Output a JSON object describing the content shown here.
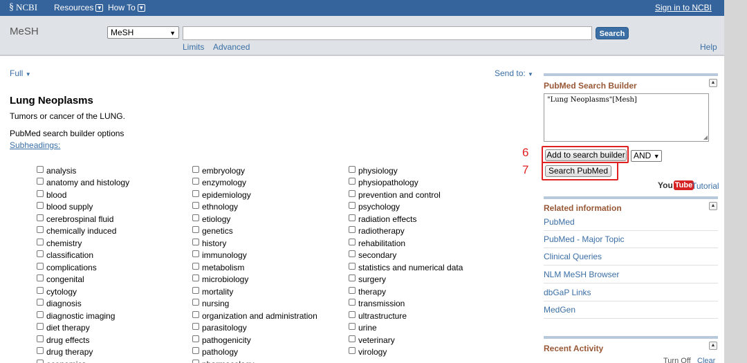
{
  "topbar": {
    "logo": "NCBI",
    "resources": "Resources",
    "howto": "How To",
    "signin": "Sign in to NCBI"
  },
  "searchbar": {
    "db_title": "MeSH",
    "db_selected": "MeSH",
    "query": "",
    "search_label": "Search",
    "limits": "Limits",
    "advanced": "Advanced",
    "help": "Help"
  },
  "main": {
    "full": "Full",
    "sendto": "Send to:",
    "title": "Lung Neoplasms",
    "description": "Tumors or cancer of the LUNG.",
    "builder_options": "PubMed search builder options",
    "subheadings_label": "Subheadings:",
    "subheadings": {
      "col1": [
        "analysis",
        "anatomy and histology",
        "blood",
        "blood supply",
        "cerebrospinal fluid",
        "chemically induced",
        "chemistry",
        "classification",
        "complications",
        "congenital",
        "cytology",
        "diagnosis",
        "diagnostic imaging",
        "diet therapy",
        "drug effects",
        "drug therapy",
        "economics"
      ],
      "col2": [
        "embryology",
        "enzymology",
        "epidemiology",
        "ethnology",
        "etiology",
        "genetics",
        "history",
        "immunology",
        "metabolism",
        "microbiology",
        "mortality",
        "nursing",
        "organization and administration",
        "parasitology",
        "pathogenicity",
        "pathology",
        "pharmacology"
      ],
      "col3": [
        "physiology",
        "physiopathology",
        "prevention and control",
        "psychology",
        "radiation effects",
        "radiotherapy",
        "rehabilitation",
        "secondary",
        "statistics and numerical data",
        "surgery",
        "therapy",
        "transmission",
        "ultrastructure",
        "urine",
        "veterinary",
        "virology"
      ]
    }
  },
  "right_panel": {
    "builder_heading": "PubMed Search Builder",
    "builder_query": "\"Lung Neoplasms\"[Mesh]",
    "add_builder": "Add to search builder",
    "operator": "AND",
    "search_pubmed": "Search PubMed",
    "annotation_6": "6",
    "annotation_7": "7",
    "youtube_you": "You",
    "youtube_tube": "Tube",
    "tutorial": "Tutorial",
    "related_heading": "Related information",
    "related_links": [
      "PubMed",
      "PubMed - Major Topic",
      "Clinical Queries",
      "NLM MeSH Browser",
      "dbGaP Links",
      "MedGen"
    ],
    "recent_heading": "Recent Activity",
    "turn_off": "Turn Off",
    "clear": "Clear"
  },
  "colors": {
    "topbar": "#35639b",
    "link": "#3a6ea5",
    "panel_heading": "#985735",
    "annotation": "#e02020"
  }
}
